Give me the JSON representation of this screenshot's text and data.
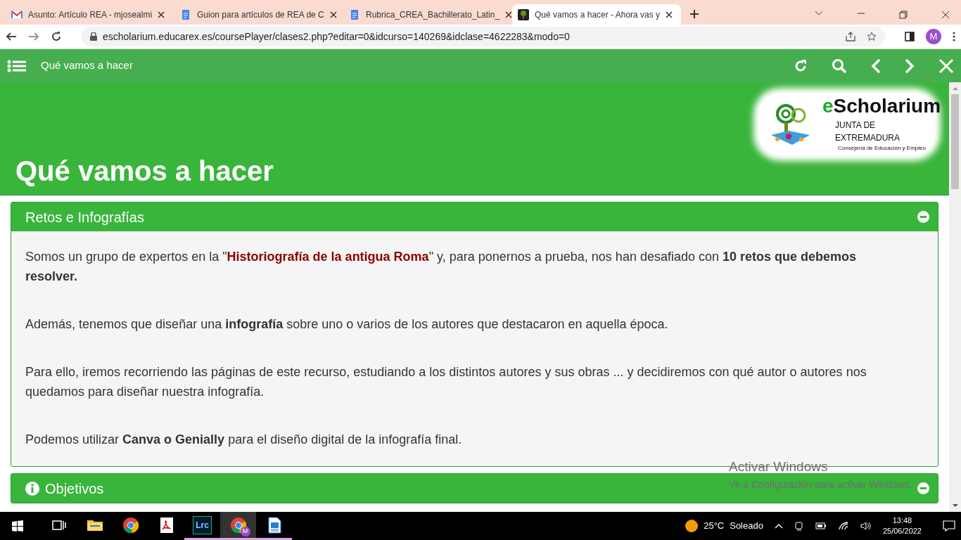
{
  "browser": {
    "tabs": [
      {
        "title": "Asunto: Artículo REA - mjosealmi",
        "kind": "mail",
        "selected": false
      },
      {
        "title": "Guion para artículos de REA de C",
        "kind": "doc",
        "selected": false
      },
      {
        "title": "Rubrica_CREA_Bachillerato_Latin_",
        "kind": "doc",
        "selected": false
      },
      {
        "title": "Qué vamos a hacer - Ahora vas y",
        "kind": "site",
        "selected": true
      }
    ],
    "address": "escholarium.educarex.es/coursePlayer/clases2.php?editar=0&idcurso=140269&idclase=4622283&modo=0",
    "profile": "M"
  },
  "app_bar": {
    "title": "Qué vamos a hacer"
  },
  "header": {
    "title": "Qué vamos a hacer",
    "logo": {
      "name_prefix": "e",
      "name_rest": "Scholarium",
      "line_1": "JUNTA DE EXTREMADURA",
      "line_2": "Consejería de Educación y Empleo"
    }
  },
  "sections": [
    {
      "title": "Retos e Infografías",
      "kind": "plain",
      "expanded": true,
      "paragraphs": [
        [
          {
            "kind": "plain",
            "text": "Somos un grupo de expertos en la \""
          },
          {
            "kind": "highlight",
            "text": "Historiografía de la antigua Roma"
          },
          {
            "kind": "plain",
            "text": "\" y, para ponernos a prueba, nos han desafiado con "
          },
          {
            "kind": "bold",
            "text": "10 retos que debemos resolver."
          }
        ],
        [
          {
            "kind": "plain",
            "text": "Además, tenemos que diseñar una "
          },
          {
            "kind": "bold",
            "text": "infografía"
          },
          {
            "kind": "plain",
            "text": " sobre uno o varios de los autores que destacaron en aquella época."
          }
        ],
        [
          {
            "kind": "plain",
            "text": "Para ello, iremos recorriendo las páginas de este recurso, estudiando a los distintos autores y sus obras ... y decidiremos con qué autor o autores nos quedamos para diseñar nuestra infografía."
          }
        ],
        [
          {
            "kind": "plain",
            "text": "Podemos utilizar "
          },
          {
            "kind": "bold",
            "text": "Canva o Genially"
          },
          {
            "kind": "plain",
            "text": " para el diseño digital de la infografía final."
          }
        ]
      ]
    },
    {
      "title": "Objetivos",
      "kind": "info",
      "expanded": true
    }
  ],
  "watermark": {
    "title": "Activar Windows",
    "text": "Ve a Configuración para activar Windows."
  },
  "taskbar": {
    "apps": [
      {
        "kind": "task-view",
        "open": false,
        "selected": false
      },
      {
        "kind": "folder",
        "open": false,
        "selected": false
      },
      {
        "kind": "chrome",
        "open": false,
        "selected": false
      },
      {
        "kind": "pdf",
        "open": false,
        "selected": false
      },
      {
        "kind": "lrc",
        "label": "Lrc",
        "open": true,
        "selected": false
      },
      {
        "kind": "chrome-profile",
        "label": "M",
        "open": true,
        "selected": true
      },
      {
        "kind": "writer",
        "open": true,
        "selected": false
      }
    ],
    "weather": {
      "temp": "25°C",
      "text": "Soleado"
    },
    "time": "13:48",
    "date": "25/06/2022"
  }
}
